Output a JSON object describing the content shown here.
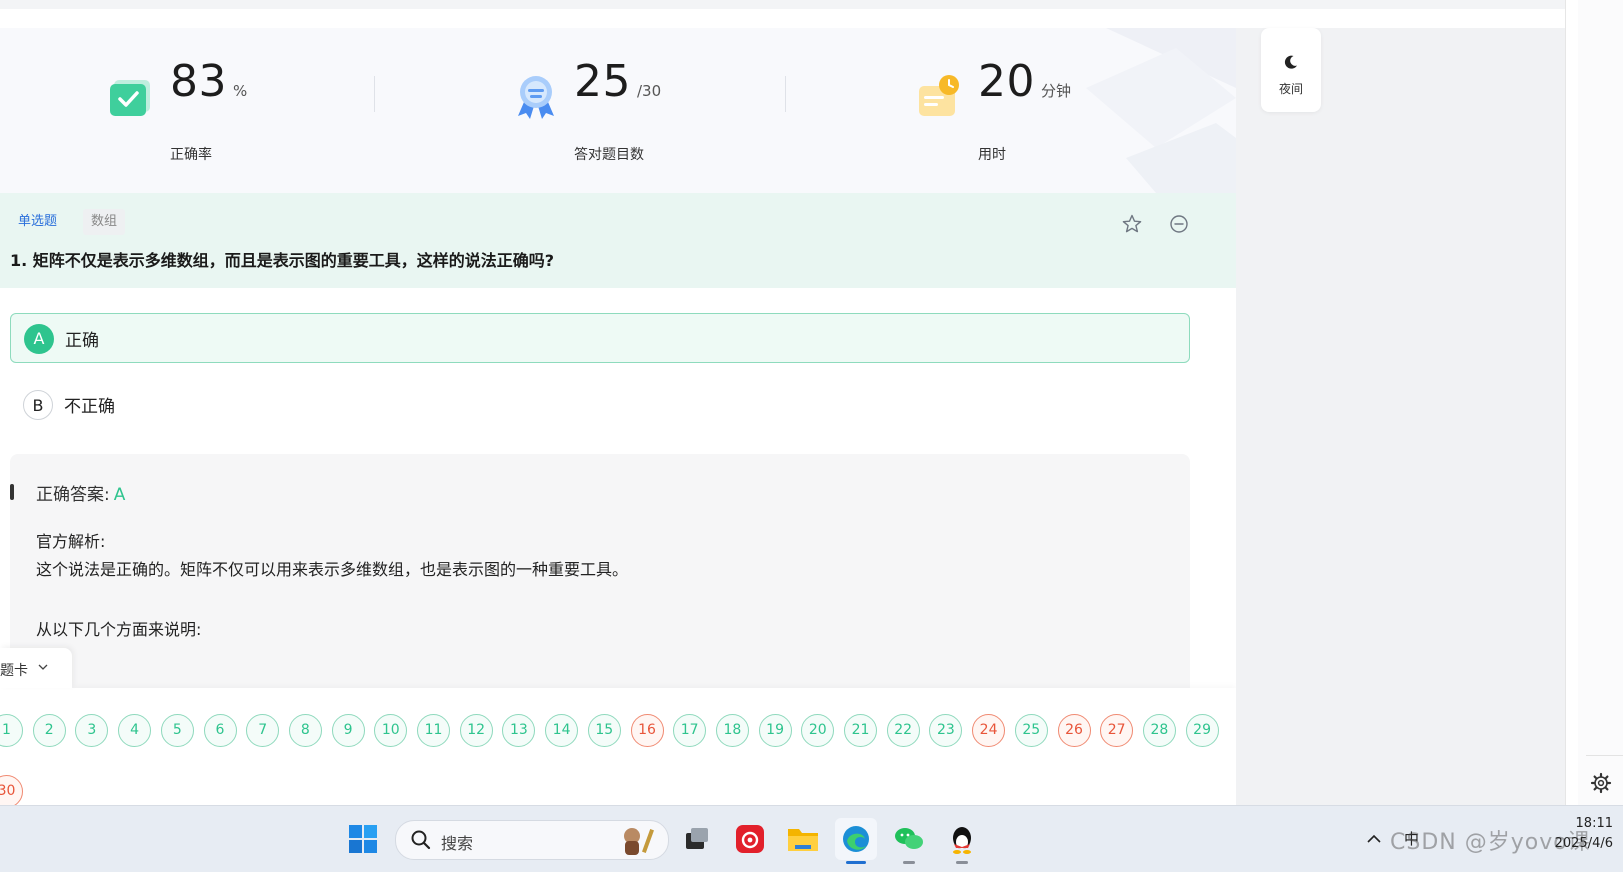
{
  "stats": {
    "accuracy": {
      "value": "83",
      "unit": "%",
      "label": "正确率"
    },
    "answered": {
      "value": "25",
      "unit": "/30",
      "label": "答对题目数"
    },
    "time": {
      "value": "20",
      "unit": "分钟",
      "label": "用时"
    }
  },
  "night_label": "夜间",
  "question": {
    "type_tag": "单选题",
    "category_tag": "数组",
    "title": "1. 矩阵不仅是表示多维数组，而且是表示图的重要工具，这样的说法正确吗?"
  },
  "options": [
    {
      "letter": "A",
      "text": "正确"
    },
    {
      "letter": "B",
      "text": "不正确"
    }
  ],
  "explanation": {
    "answer_label": "正确答案:",
    "answer_value": "A",
    "official_label": "官方解析:",
    "paragraph": "这个说法是正确的。矩阵不仅可以用来表示多维数组，也是表示图的一种重要工具。",
    "partial": "从以下几个方面来说明:"
  },
  "answer_card": {
    "label": "题卡",
    "numbers": [
      "1",
      "2",
      "3",
      "4",
      "5",
      "6",
      "7",
      "8",
      "9",
      "10",
      "11",
      "12",
      "13",
      "14",
      "15",
      "16",
      "17",
      "18",
      "19",
      "20",
      "21",
      "22",
      "23",
      "24",
      "25",
      "26",
      "27",
      "28",
      "29",
      "30"
    ],
    "wrong": [
      "16",
      "24",
      "26",
      "27",
      "30"
    ]
  },
  "taskbar": {
    "search_placeholder": "搜索",
    "ime": "中",
    "time": "18:11",
    "date": "2025/4/6",
    "watermark": "CSDN @岁yovo课"
  },
  "colors": {
    "accent_green": "#2ec48e",
    "wrong_red": "#e8553a",
    "link_blue": "#2a6fdb"
  }
}
